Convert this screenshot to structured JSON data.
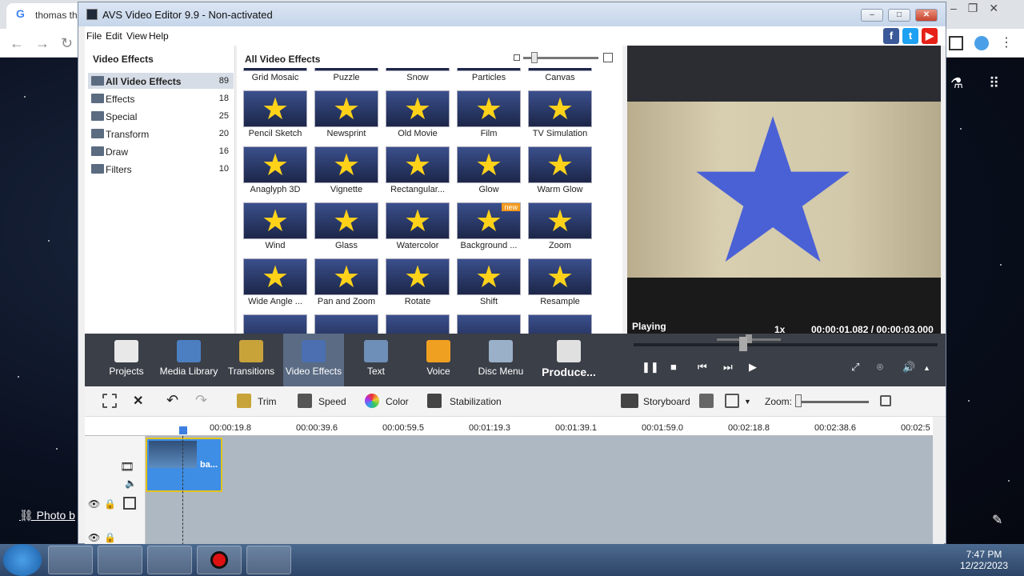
{
  "browser": {
    "tab_title": "thomas th",
    "tab_icon": "G",
    "photo_credit": "Photo b"
  },
  "app": {
    "title": "AVS Video Editor 9.9 - Non-activated",
    "menu": [
      "File",
      "Edit",
      "View",
      "Help"
    ],
    "social": [
      {
        "name": "facebook",
        "glyph": "f",
        "color": "#3b5998"
      },
      {
        "name": "twitter",
        "glyph": "t",
        "color": "#1da1f2"
      },
      {
        "name": "youtube",
        "glyph": "▶",
        "color": "#e62117"
      }
    ]
  },
  "categories": {
    "title": "Video Effects",
    "items": [
      {
        "name": "All Video Effects",
        "count": "89",
        "selected": true
      },
      {
        "name": "Effects",
        "count": "18"
      },
      {
        "name": "Special",
        "count": "25"
      },
      {
        "name": "Transform",
        "count": "20"
      },
      {
        "name": "Draw",
        "count": "16"
      },
      {
        "name": "Filters",
        "count": "10"
      }
    ]
  },
  "effects": {
    "title": "All Video Effects",
    "items": [
      {
        "label": "Grid Mosaic"
      },
      {
        "label": "Puzzle"
      },
      {
        "label": "Snow"
      },
      {
        "label": "Particles"
      },
      {
        "label": "Canvas"
      },
      {
        "label": "Pencil Sketch"
      },
      {
        "label": "Newsprint"
      },
      {
        "label": "Old Movie"
      },
      {
        "label": "Film"
      },
      {
        "label": "TV Simulation"
      },
      {
        "label": "Anaglyph 3D"
      },
      {
        "label": "Vignette"
      },
      {
        "label": "Rectangular..."
      },
      {
        "label": "Glow"
      },
      {
        "label": "Warm Glow"
      },
      {
        "label": "Wind"
      },
      {
        "label": "Glass"
      },
      {
        "label": "Watercolor"
      },
      {
        "label": "Background ...",
        "badge": "new"
      },
      {
        "label": "Zoom"
      },
      {
        "label": "Wide Angle ..."
      },
      {
        "label": "Pan and Zoom"
      },
      {
        "label": "Rotate"
      },
      {
        "label": "Shift"
      },
      {
        "label": "Resample"
      }
    ]
  },
  "preview": {
    "status": "Playing",
    "speed": "1x",
    "time": "00:00:01.082 / 00:00:03.000"
  },
  "tools": [
    {
      "label": "Projects",
      "color": "#e8e8e8"
    },
    {
      "label": "Media Library",
      "color": "#4c7fc2"
    },
    {
      "label": "Transitions",
      "color": "#c8a33a"
    },
    {
      "label": "Video Effects",
      "color": "#4b6fb0",
      "selected": true
    },
    {
      "label": "Text",
      "color": "#6d8fb8"
    },
    {
      "label": "Voice",
      "color": "#f0a020"
    },
    {
      "label": "Disc Menu",
      "color": "#9ab0c8"
    },
    {
      "label": "Produce...",
      "color": "#e0e0e0",
      "produce": true
    }
  ],
  "timeline_toolbar": {
    "trim": "Trim",
    "speed": "Speed",
    "color": "Color",
    "stabilization": "Stabilization",
    "storyboard": "Storyboard",
    "zoom": "Zoom:"
  },
  "ruler": [
    "00:00:19.8",
    "00:00:39.6",
    "00:00:59.5",
    "00:01:19.3",
    "00:01:39.1",
    "00:01:59.0",
    "00:02:18.8",
    "00:02:38.6",
    "00:02:5"
  ],
  "clip": {
    "label": "ba..."
  },
  "clock": {
    "time": "7:47 PM",
    "date": "12/22/2023"
  }
}
